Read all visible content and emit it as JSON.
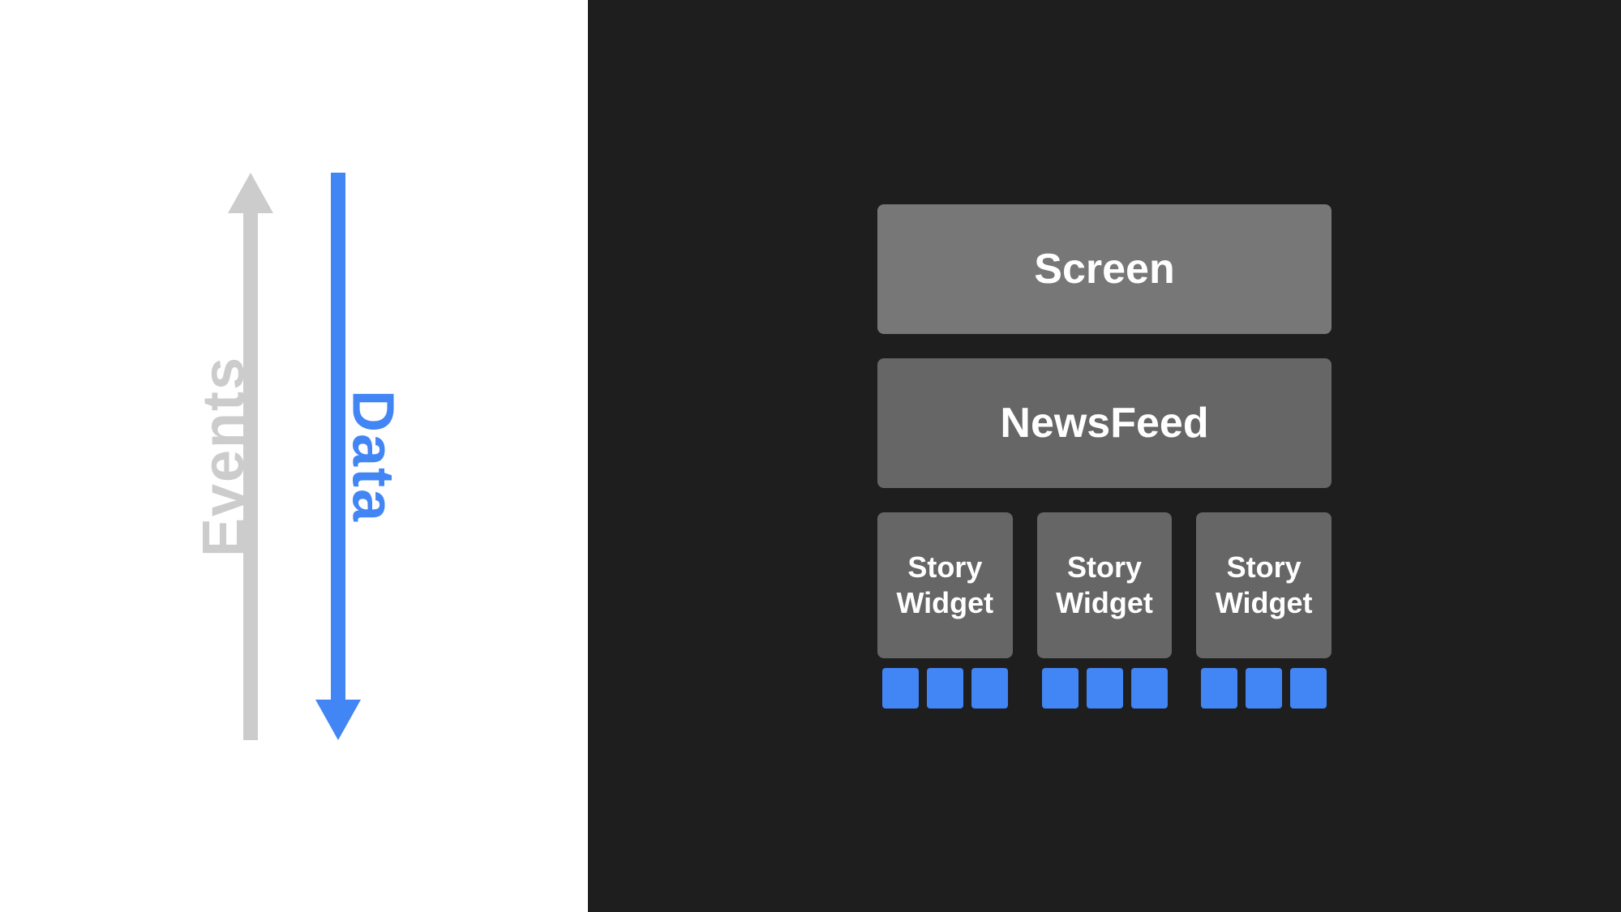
{
  "left_panel": {
    "events_label": "Events",
    "data_label": "Data"
  },
  "right_panel": {
    "screen_label": "Screen",
    "newsfeed_label": "NewsFeed",
    "story_widgets": [
      {
        "label": "Story\nWidget",
        "dots": [
          1,
          2,
          3
        ]
      },
      {
        "label": "Story\nWidget",
        "dots": [
          1,
          2,
          3
        ]
      },
      {
        "label": "Story\nWidget",
        "dots": [
          1,
          2,
          3
        ]
      }
    ]
  },
  "colors": {
    "blue": "#4285f4",
    "gray_arrow": "#cccccc",
    "dark_bg": "#1e1e1e",
    "box_bg": "#666666",
    "screen_bg": "#777777",
    "white": "#ffffff"
  }
}
